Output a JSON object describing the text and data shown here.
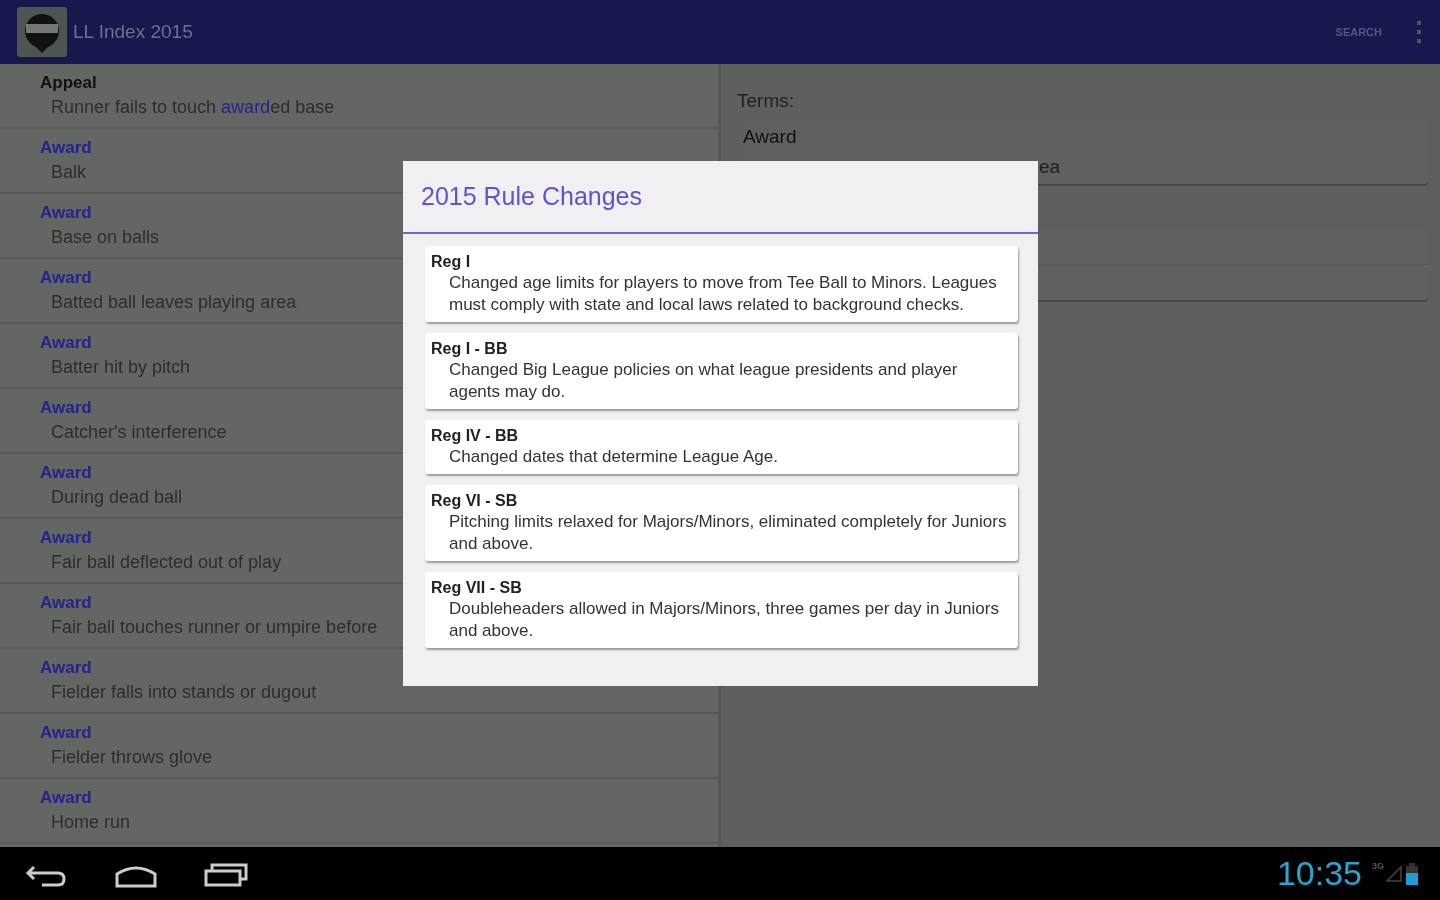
{
  "app_bar": {
    "title": "LL Index 2015",
    "actions": [
      "SEARCH"
    ]
  },
  "index_list": [
    {
      "title": "Appeal",
      "title_highlight": false,
      "subtitle": [
        {
          "text": "Runner fails to touch ",
          "highlight": false
        },
        {
          "text": "award",
          "highlight": true
        },
        {
          "text": "ed base",
          "highlight": false
        }
      ]
    },
    {
      "title": "Award",
      "title_highlight": true,
      "subtitle": [
        {
          "text": "Balk",
          "highlight": false
        }
      ]
    },
    {
      "title": "Award",
      "title_highlight": true,
      "subtitle": [
        {
          "text": "Base on balls",
          "highlight": false
        }
      ]
    },
    {
      "title": "Award",
      "title_highlight": true,
      "subtitle": [
        {
          "text": "Batted ball leaves playing area",
          "highlight": false
        }
      ]
    },
    {
      "title": "Award",
      "title_highlight": true,
      "subtitle": [
        {
          "text": "Batter hit by pitch",
          "highlight": false
        }
      ]
    },
    {
      "title": "Award",
      "title_highlight": true,
      "subtitle": [
        {
          "text": "Catcher's interference",
          "highlight": false
        }
      ]
    },
    {
      "title": "Award",
      "title_highlight": true,
      "subtitle": [
        {
          "text": "During dead ball",
          "highlight": false
        }
      ]
    },
    {
      "title": "Award",
      "title_highlight": true,
      "subtitle": [
        {
          "text": "Fair ball deflected out of play",
          "highlight": false
        }
      ]
    },
    {
      "title": "Award",
      "title_highlight": true,
      "subtitle": [
        {
          "text": "Fair ball touches runner or umpire before",
          "highlight": false
        }
      ]
    },
    {
      "title": "Award",
      "title_highlight": true,
      "subtitle": [
        {
          "text": "Fielder falls into stands or dugout",
          "highlight": false
        }
      ]
    },
    {
      "title": "Award",
      "title_highlight": true,
      "subtitle": [
        {
          "text": "Fielder throws glove",
          "highlight": false
        }
      ]
    },
    {
      "title": "Award",
      "title_highlight": true,
      "subtitle": [
        {
          "text": "Home run",
          "highlight": false
        }
      ]
    }
  ],
  "detail": {
    "label": "Terms:",
    "term_card": {
      "title": "Award",
      "line_2": "ea"
    }
  },
  "dialog": {
    "title": "2015 Rule Changes",
    "items": [
      {
        "title": "Reg I",
        "text": "Changed age limits for players to move from Tee Ball to Minors. Leagues must comply with state and local laws related to background checks."
      },
      {
        "title": "Reg I - BB",
        "text": "Changed Big League policies on what league presidents and player agents may do."
      },
      {
        "title": "Reg IV - BB",
        "text": "Changed dates that determine League Age."
      },
      {
        "title": "Reg VI - SB",
        "text": "Pitching limits relaxed for Majors/Minors, eliminated completely for Juniors and above."
      },
      {
        "title": "Reg VII - SB",
        "text": "Doubleheaders allowed in Majors/Minors, three games per day in Juniors and above."
      }
    ]
  },
  "system_bar": {
    "time": "10:35",
    "network": "3G"
  }
}
